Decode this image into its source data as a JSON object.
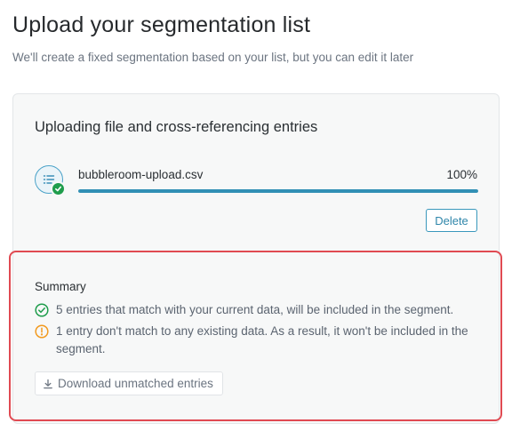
{
  "header": {
    "title": "Upload your segmentation list",
    "subtitle": "We'll create a fixed segmentation based on your list, but you can edit it later"
  },
  "upload": {
    "title": "Uploading file and cross-referencing entries",
    "file_name": "bubbleroom-upload.csv",
    "progress_label": "100%",
    "progress_value": 1.0,
    "delete_label": "Delete",
    "file_icon": "list-file-icon",
    "status_icon": "check-badge-icon"
  },
  "summary": {
    "title": "Summary",
    "matched_text": "5 entries that match with your current data, will be included in the segment.",
    "unmatched_text": "1 entry don't match to any existing data. As a result, it won't be included in the segment.",
    "matched_icon": "check-circle-icon",
    "unmatched_icon": "warning-circle-icon",
    "download_label": "Download unmatched entries",
    "download_icon": "download-icon"
  },
  "colors": {
    "accent": "#3190b5",
    "success": "#1f9d4c",
    "warning": "#f29a1f",
    "highlight": "#e04a52"
  }
}
